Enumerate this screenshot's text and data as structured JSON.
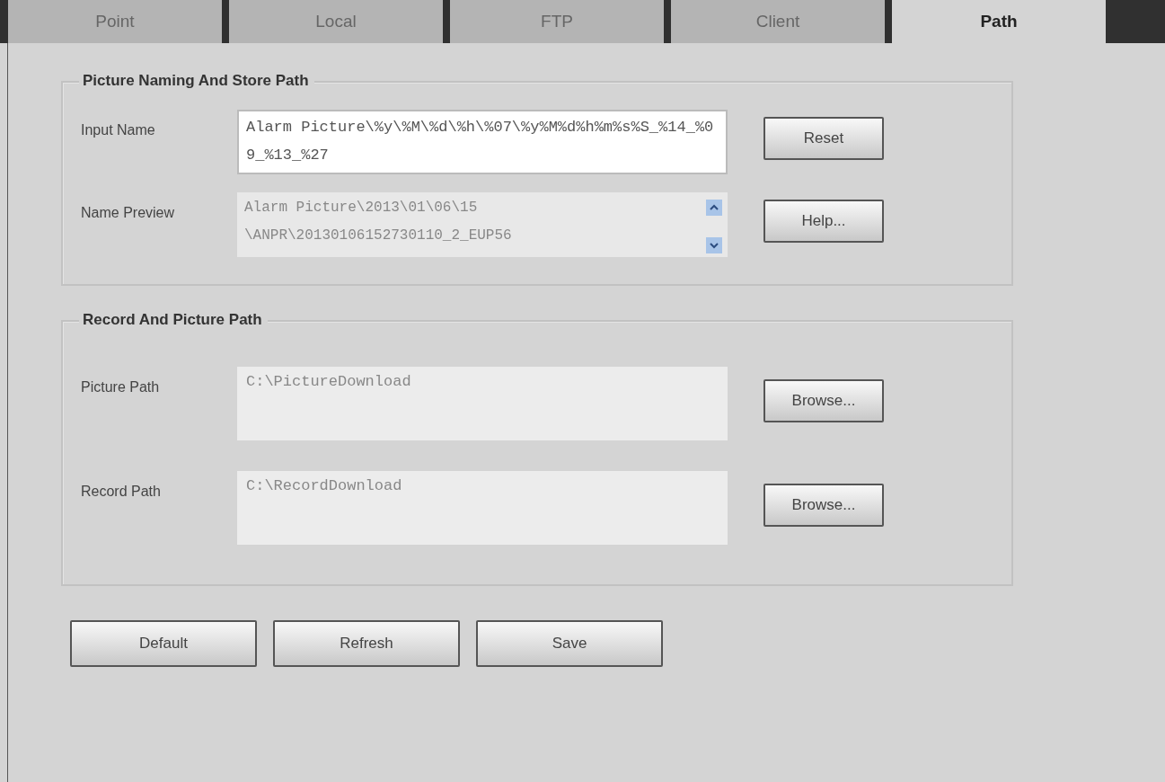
{
  "tabs": [
    {
      "label": "Point",
      "selected": false
    },
    {
      "label": "Local",
      "selected": false
    },
    {
      "label": "FTP",
      "selected": false
    },
    {
      "label": "Client",
      "selected": false
    },
    {
      "label": "Path",
      "selected": true
    }
  ],
  "groups": [
    {
      "title": "Picture Naming And Store Path",
      "rows": [
        {
          "kind": "input",
          "label": "Input Name",
          "value": "Alarm Picture\\%y\\%M\\%d\\%h\\%07\\%y%M%d%h%m%s%S_%14_%09_%13_%27",
          "button": "Reset"
        },
        {
          "kind": "preview",
          "label": "Name Preview",
          "value": "Alarm Picture\\2013\\01\\06\\15\n\\ANPR\\20130106152730110_2_EUP56",
          "button": "Help..."
        }
      ]
    },
    {
      "title": "Record And Picture Path",
      "rows": [
        {
          "kind": "path",
          "label": "Picture Path",
          "value": "C:\\PictureDownload",
          "button": "Browse..."
        },
        {
          "kind": "path",
          "label": "Record Path",
          "value": "C:\\RecordDownload",
          "button": "Browse..."
        }
      ]
    }
  ],
  "buttons": [
    "Default",
    "Refresh",
    "Save"
  ]
}
